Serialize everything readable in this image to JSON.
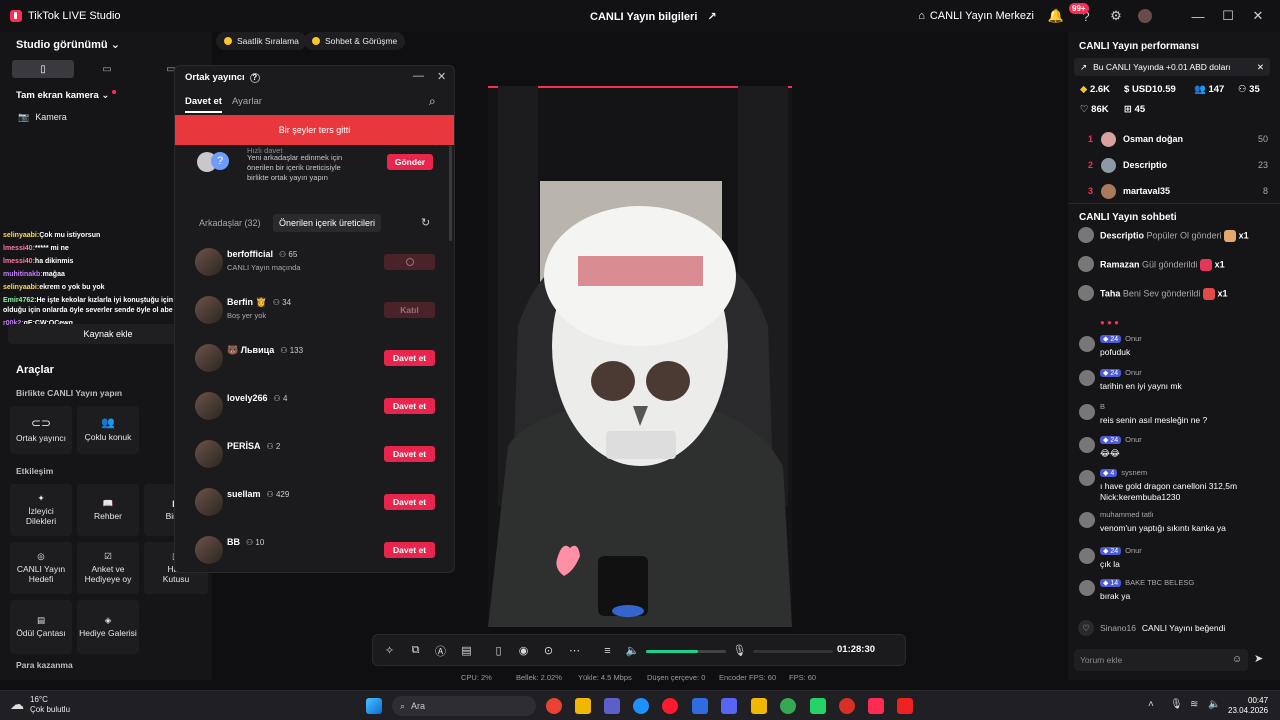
{
  "titlebar": {
    "app_name": "TikTok LIVE Studio",
    "center_title": "CANLI Yayın bilgileri",
    "live_center": "CANLI Yayın Merkezi",
    "notif_count": "99+"
  },
  "left": {
    "studio_view": "Studio görünümü",
    "fullscreen_camera": "Tam ekran kamera",
    "camera": "Kamera",
    "add_source": "Kaynak ekle",
    "tools": "Araçlar",
    "collab_heading": "Birlikte CANLI Yayın yapın",
    "cohost": "Ortak yayıncı",
    "multi_guest": "Çoklu konuk",
    "interaction": "Etkileşim",
    "viewer_wishes": "İzleyici Dilekleri",
    "guide": "Rehber",
    "together": "Birlikt",
    "live_goal": "CANLI Yayın Hedefi",
    "poll": "Anket ve Hediyeye oy",
    "treasure": "Hazi Kutusu",
    "reward_bag": "Ödül Çantası",
    "gift_gallery": "Hediye Galerisi",
    "monetize": "Para kazanma",
    "chat_overlay": [
      {
        "user": "selinyaabi:",
        "msg": "Çok mu istiyorsun",
        "color": "#ffd95a"
      },
      {
        "user": "lmessi40:",
        "msg": "***** mi ne",
        "color": "#ff7aa8"
      },
      {
        "user": "lmessi40:",
        "msg": "ha dikinmis",
        "color": "#ff7aa8"
      },
      {
        "user": "muhitinakb:",
        "msg": "mağaa",
        "color": "#c57bff"
      },
      {
        "user": "selinyaabi:",
        "msg": "ekrem o yok bu yok",
        "color": "#ffd95a"
      },
      {
        "user": "Emir4762:",
        "msg": "He işte kekolar kızlarla iyi konuştuğu için ve piçlik",
        "color": "#8cf5a1"
      },
      {
        "user": "",
        "msg": "olduğu için onlarda öyle severler sende öyle ol abe",
        "color": "#ffffff"
      },
      {
        "user": "r00k2:",
        "msg": "qE:CW:QCewq",
        "color": "#c57bff"
      }
    ]
  },
  "pills": {
    "hourly": "Saatlik Sıralama",
    "chat": "Sohbet & Görüşme"
  },
  "dialog": {
    "title": "Ortak yayıncı",
    "tab_invite": "Davet et",
    "tab_settings": "Ayarlar",
    "error": "Bir şeyler ters gitti",
    "quick_title": "Hızlı davet",
    "quick_text": "Yeni arkadaşlar edinmek için önerilen bir içerik üreticisiyle birlikte ortak yayın yapın",
    "send": "Gönder",
    "friends_tab": "Arkadaşlar (32)",
    "suggested_tab": "Önerilen içerik üreticileri",
    "people": [
      {
        "name": "berfofficial",
        "count": "65",
        "sub": "CANLI Yayın maçında",
        "btn": ""
      },
      {
        "name": "Berfin 👸",
        "count": "34",
        "sub": "Boş yer yok",
        "btn": "Katıl"
      },
      {
        "name": "🐻 Львица",
        "count": "133",
        "sub": "",
        "btn": "Davet et"
      },
      {
        "name": "lovely266",
        "count": "4",
        "sub": "",
        "btn": "Davet et"
      },
      {
        "name": "PERİSA",
        "count": "2",
        "sub": "",
        "btn": "Davet et"
      },
      {
        "name": "suellam",
        "count": "429",
        "sub": "",
        "btn": "Davet et"
      },
      {
        "name": "BB",
        "count": "10",
        "sub": "",
        "btn": "Davet et"
      }
    ]
  },
  "toolbar": {
    "timer": "01:28:30",
    "volume": 0.65
  },
  "stats": {
    "cpu": "CPU:  2%",
    "memory": "Bellek:  2.02%",
    "upload": "Yükle:  4.5 Mbps",
    "dropped": "Düşen çerçeve:  0",
    "encoder_fps": "Encoder FPS:  60",
    "fps": "FPS:  60"
  },
  "right": {
    "perf_title": "CANLI Yayın performansı",
    "perf_banner": "Bu CANLI Yayında +0.01 ABD doları",
    "stat1": "2.6K",
    "stat2": "USD10.59",
    "stat3": "147",
    "stat4": "35",
    "stat5": "86K",
    "stat6": "45",
    "ranking": [
      {
        "n": "1",
        "name": "Osman doğan",
        "v": "50"
      },
      {
        "n": "2",
        "name": "Descriptio",
        "v": "23"
      },
      {
        "n": "3",
        "name": "martaval35",
        "v": "8"
      }
    ],
    "chat_title": "CANLI Yayın sohbeti",
    "gifts": [
      {
        "user": "Descriptio",
        "text": "Popüler Ol gönderi",
        "x": "x1"
      },
      {
        "user": "Ramazan",
        "text": "Gül gönderildi",
        "x": "x1"
      },
      {
        "user": "Taha",
        "text": "Beni Sev gönderildi",
        "x": "x1"
      }
    ],
    "comments": [
      {
        "lv": "24",
        "user": "Onur",
        "msg": "pofuduk"
      },
      {
        "lv": "24",
        "user": "Onur",
        "msg": "tarihin en iyi yaynı mk"
      },
      {
        "lv": "",
        "user": "B",
        "msg": "reis senin asıl mesleğin ne ?"
      },
      {
        "lv": "24",
        "user": "Onur",
        "msg": "😂😂"
      },
      {
        "lv": "4",
        "user": "sysnem",
        "msg": "ı have gold dragon canelloni 312,5m Nick:kerembuba1230"
      },
      {
        "lv": "",
        "user": "muhammed tatlı",
        "msg": "venom'un yaptığı sıkıntı kanka ya"
      },
      {
        "lv": "24",
        "user": "Onur",
        "msg": "çık la"
      },
      {
        "lv": "14",
        "user": "BAKE TBC BELESG",
        "msg": "bırak ya"
      }
    ],
    "liked_user": "Sinano16",
    "liked_text": "CANLI Yayını beğendi",
    "comment_placeholder": "Yorum ekle"
  },
  "taskbar": {
    "weather_temp": "16°C",
    "weather_desc": "Çok bulutlu",
    "search": "Ara",
    "time": "00:47",
    "date": "23.04.2026"
  }
}
